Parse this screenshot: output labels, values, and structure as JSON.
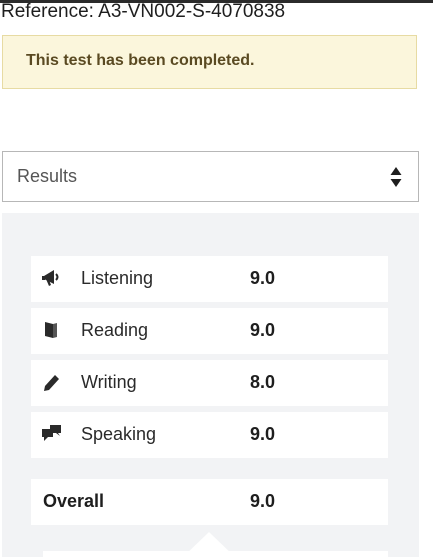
{
  "reference": "Reference: A3-VN002-S-4070838",
  "notice": "This test has been completed.",
  "select": {
    "value": "Results",
    "icon": "sort-arrows-icon"
  },
  "results": [
    {
      "label": "Listening",
      "score": "9.0",
      "icon": "megaphone-icon"
    },
    {
      "label": "Reading",
      "score": "9.0",
      "icon": "book-icon"
    },
    {
      "label": "Writing",
      "score": "8.0",
      "icon": "pencil-icon"
    },
    {
      "label": "Speaking",
      "score": "9.0",
      "icon": "speech-bubbles-icon"
    }
  ],
  "overall": {
    "label": "Overall",
    "score": "9.0"
  },
  "colors": {
    "notice_bg": "#fbf6dc",
    "notice_text": "#5a4a22",
    "panel_bg": "#f2f3f5"
  }
}
